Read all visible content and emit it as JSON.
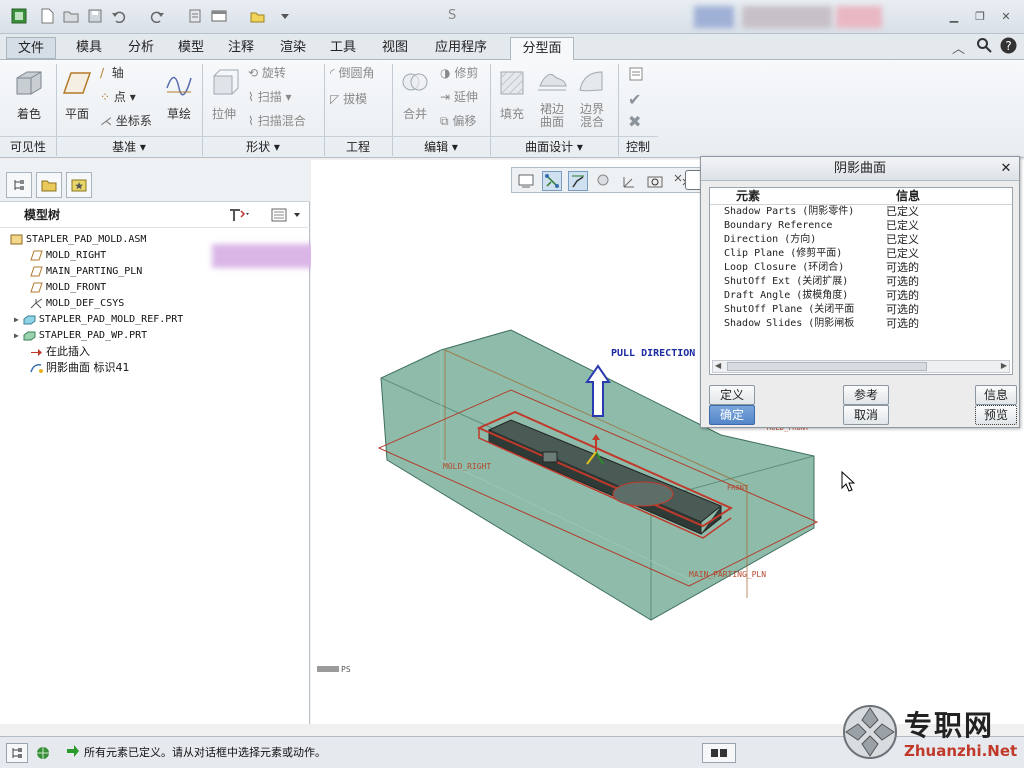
{
  "window": {
    "title_char": "S"
  },
  "tabs": [
    "文件",
    "模具",
    "分析",
    "模型",
    "注释",
    "渲染",
    "工具",
    "视图",
    "应用程序",
    "分型面"
  ],
  "ribbon": {
    "coloring": "着色",
    "plane": "平面",
    "axis": "轴",
    "point": "点",
    "csys": "坐标系",
    "sketch": "草绘",
    "extrude": "拉伸",
    "revolve": "旋转",
    "sweep": "扫描",
    "swept_blend": "扫描混合",
    "round": "倒圆角",
    "draft": "拔模",
    "merge": "合并",
    "trim": "修剪",
    "extend": "延伸",
    "offset": "偏移",
    "fill": "填充",
    "skirt": "裙边\n曲面",
    "boundary": "边界\n混合",
    "groups": {
      "visibility": "可见性",
      "datum": "基准",
      "shape": "形状",
      "engineering": "工程",
      "editing": "编辑",
      "surface_design": "曲面设计",
      "control": "控制"
    }
  },
  "model_tree": {
    "title": "模型树",
    "nodes": [
      {
        "label": "STAPLER_PAD_MOLD.ASM",
        "icon": "assembly-icon",
        "level": 0
      },
      {
        "label": "MOLD_RIGHT",
        "icon": "datum-plane-icon",
        "level": 1
      },
      {
        "label": "MAIN_PARTING_PLN",
        "icon": "datum-plane-icon",
        "level": 1
      },
      {
        "label": "MOLD_FRONT",
        "icon": "datum-plane-icon",
        "level": 1
      },
      {
        "label": "MOLD_DEF_CSYS",
        "icon": "csys-icon",
        "level": 1
      },
      {
        "label": "STAPLER_PAD_MOLD_REF.PRT",
        "icon": "part-icon",
        "level": 1
      },
      {
        "label": "STAPLER_PAD_WP.PRT",
        "icon": "part-icon",
        "level": 1
      },
      {
        "label": "在此插入",
        "icon": "insert-arrow-icon",
        "level": 1
      },
      {
        "label": "阴影曲面 标识41",
        "icon": "shadow-surface-icon",
        "level": 1
      }
    ]
  },
  "viewport": {
    "pull_direction": "PULL DIRECTION",
    "labels": [
      "MOLD_RIGHT",
      "MAIN_PARTING_PLN",
      "MOLD_FRONT",
      "FRONT"
    ],
    "corner_text": "PS"
  },
  "dialog": {
    "title": "阴影曲面",
    "col_element": "元素",
    "col_info": "信息",
    "rows": [
      {
        "element": "Shadow Parts (阴影零件)",
        "info": "已定义"
      },
      {
        "element": "Boundary Reference",
        "info": "已定义"
      },
      {
        "element": "Direction (方向)",
        "info": "已定义"
      },
      {
        "element": "Clip Plane (修剪平面)",
        "info": "已定义"
      },
      {
        "element": "Loop Closure (环闭合)",
        "info": "可选的"
      },
      {
        "element": "ShutOff Ext (关闭扩展)",
        "info": "可选的"
      },
      {
        "element": "Draft Angle (拔模角度)",
        "info": "可选的"
      },
      {
        "element": "ShutOff Plane (关闭平面",
        "info": "可选的"
      },
      {
        "element": "Shadow Slides (阴影闸板",
        "info": "可选的"
      }
    ],
    "buttons": {
      "define": "定义",
      "reference": "参考",
      "info": "信息",
      "ok": "确定",
      "cancel": "取消",
      "preview": "预览"
    }
  },
  "status": {
    "message": "所有元素已定义。请从对话框中选择元素或动作。"
  },
  "watermark": {
    "brand": "专职网",
    "url": "Zhuanzhi.Net"
  },
  "colors": {
    "mold_fill": "#6aa58e",
    "parting_line": "#c0392b",
    "dialog_ok": "#5485c8"
  }
}
